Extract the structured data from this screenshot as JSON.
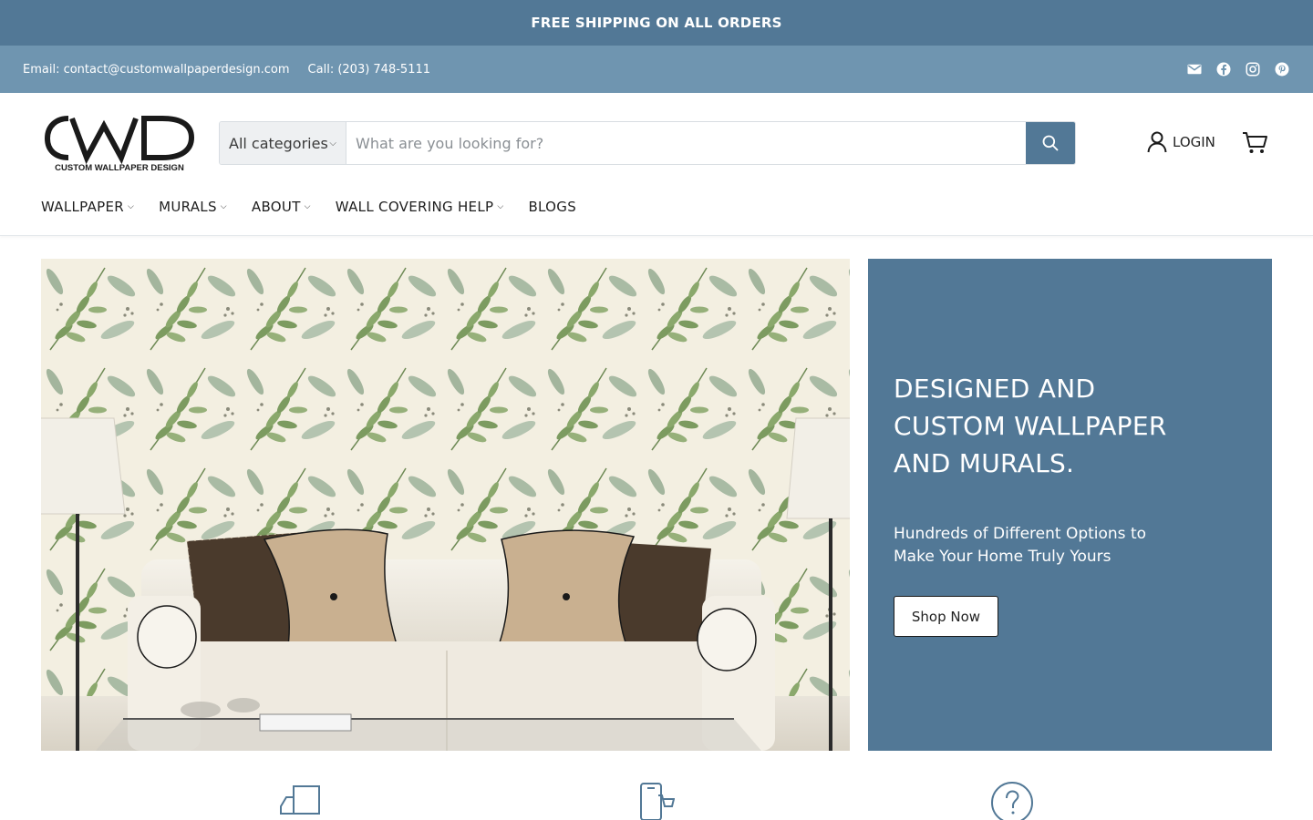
{
  "announcement": "FREE SHIPPING ON ALL ORDERS",
  "utility": {
    "email": "Email: contact@customwallpaperdesign.com",
    "call": "Call: (203) 748-5111",
    "social_icons": [
      "email-icon",
      "facebook-icon",
      "instagram-icon",
      "pinterest-icon"
    ]
  },
  "logo": {
    "mark": "CWD",
    "tagline": "CUSTOM WALLPAPER DESIGN"
  },
  "search": {
    "category": "All categories",
    "placeholder": "What are you looking for?"
  },
  "account": {
    "login": "LOGIN"
  },
  "nav": [
    {
      "label": "WALLPAPER"
    },
    {
      "label": "MURALS"
    },
    {
      "label": "ABOUT"
    },
    {
      "label": "WALL COVERING HELP"
    },
    {
      "label": "BLOGS"
    }
  ],
  "hero": {
    "title": "DESIGNED AND CUSTOM WALLPAPER AND MURALS.",
    "subtitle": "Hundreds of Different Options to Make Your Home Truly Yours",
    "cta": "Shop Now"
  },
  "colors": {
    "brand": "#527896",
    "utility_bar": "#6f95b0"
  }
}
